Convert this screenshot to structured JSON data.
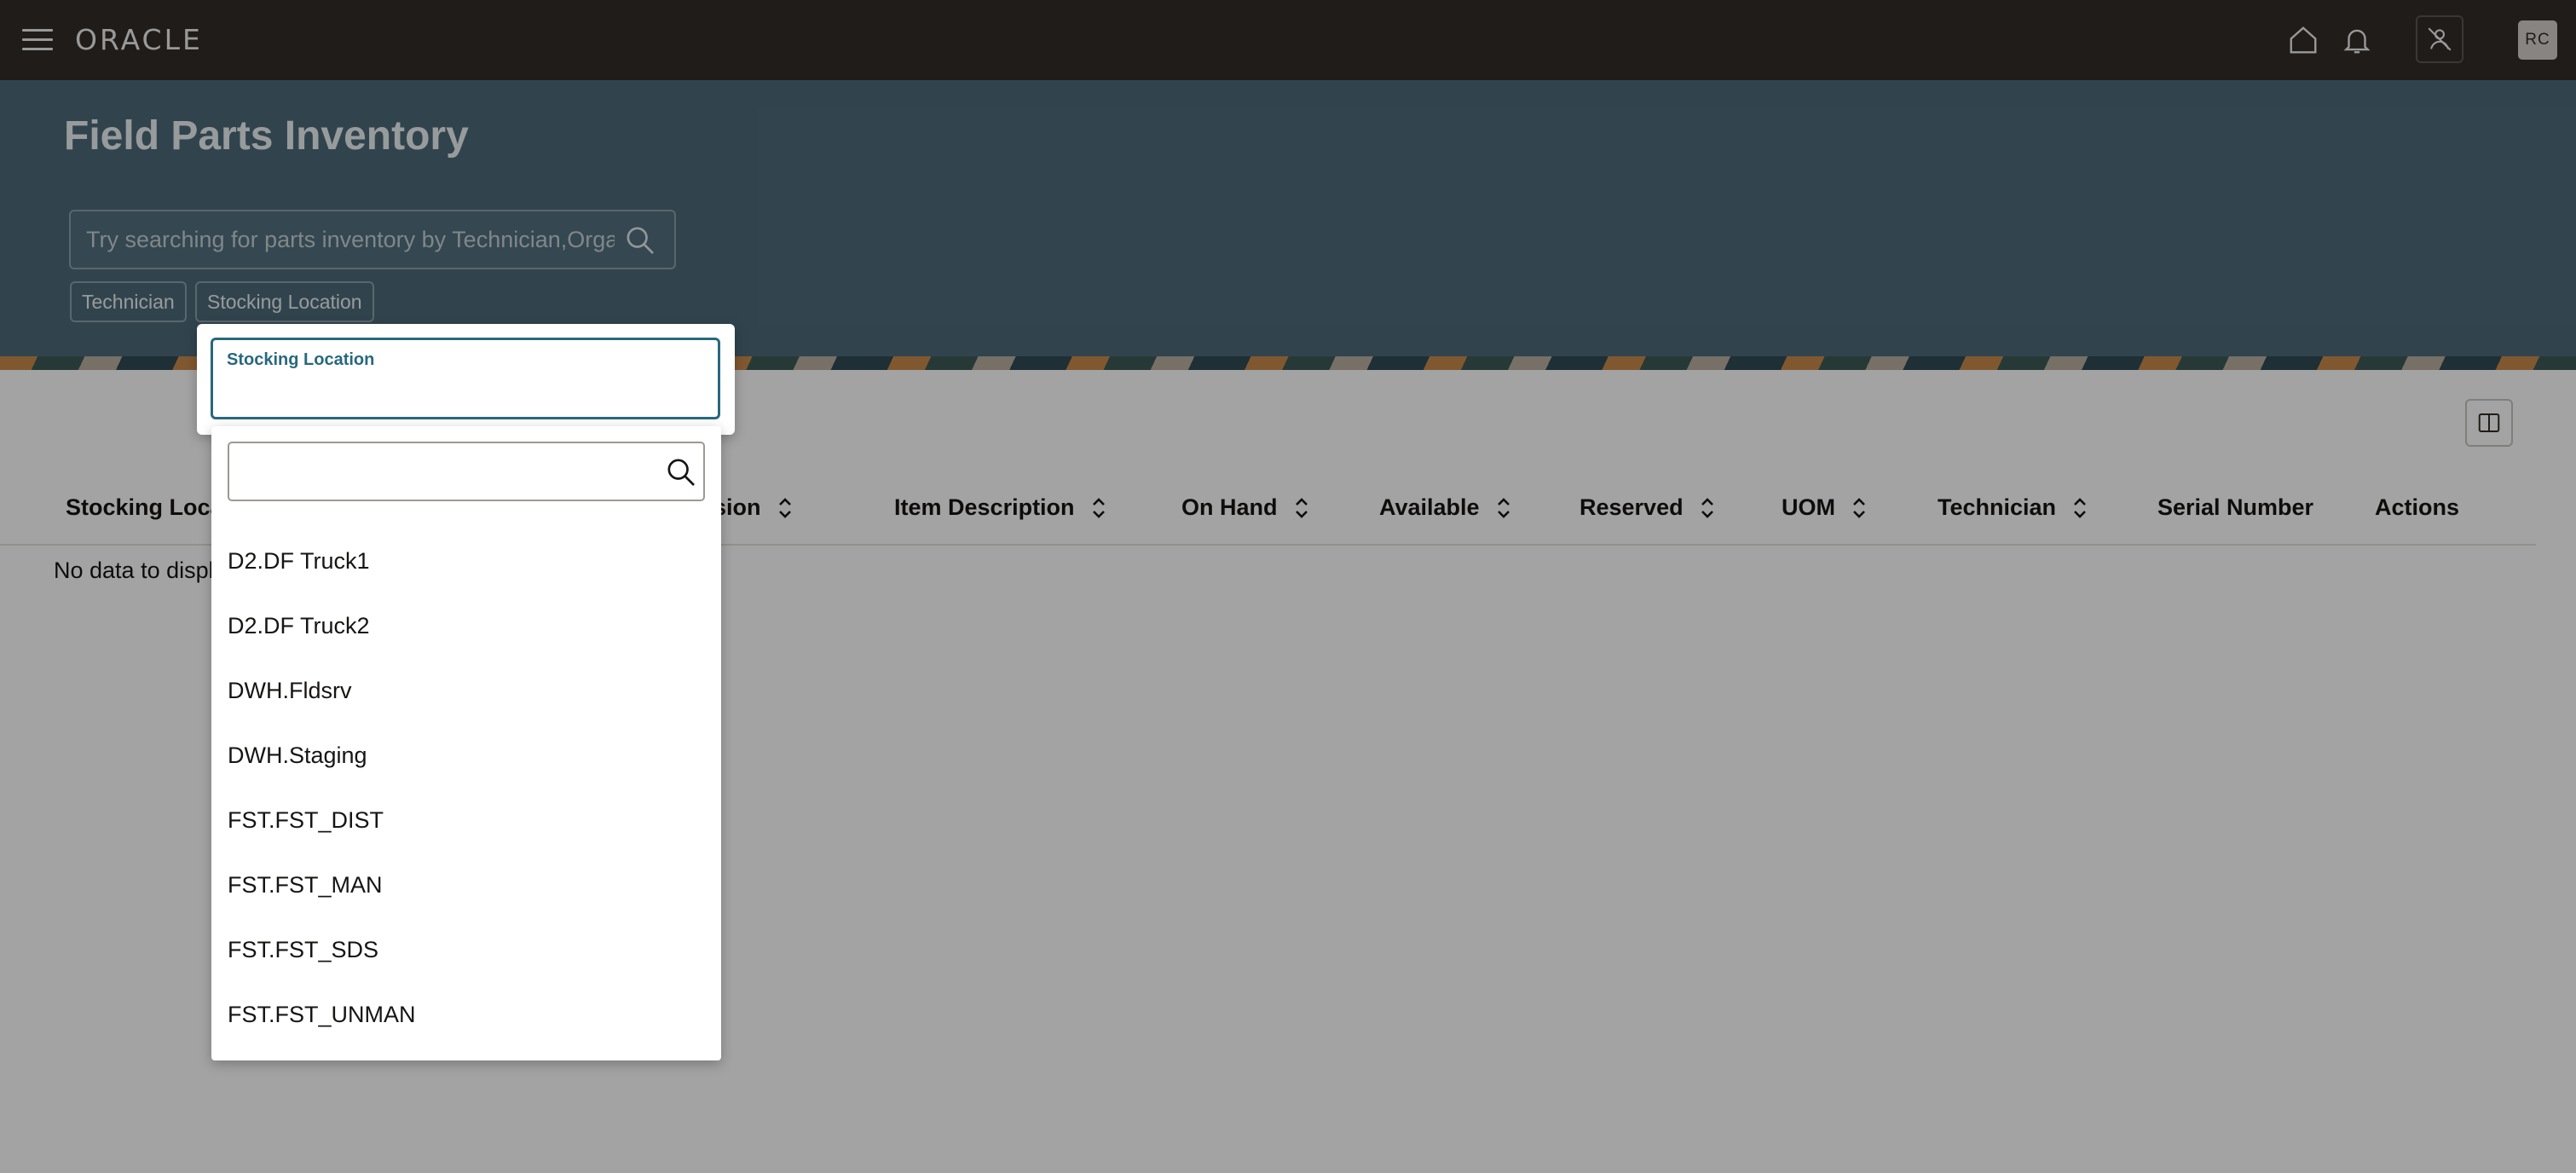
{
  "app": {
    "brand": "ORACLE",
    "avatar_initials": "RC"
  },
  "page": {
    "title": "Field Parts Inventory",
    "search_placeholder": "Try searching for parts inventory by Technician,Orga",
    "chips": [
      "Technician",
      "Stocking Location"
    ]
  },
  "table": {
    "columns": [
      "Stocking Locat",
      "Revision",
      "Item Description",
      "On Hand",
      "Available",
      "Reserved",
      "UOM",
      "Technician",
      "Serial Number",
      "Actions"
    ],
    "no_data": "No data to displa"
  },
  "dropdown": {
    "label": "Stocking Location",
    "value": "",
    "filter_value": "",
    "options": [
      "D2.DF Truck1",
      "D2.DF Truck2",
      "DWH.Fldsrv",
      "DWH.Staging",
      "FST.FST_DIST",
      "FST.FST_MAN",
      "FST.FST_SDS",
      "FST.FST_UNMAN"
    ]
  },
  "colors": {
    "topbar": "#312d2a",
    "header": "#4e6b7a",
    "accent": "#28687e"
  }
}
